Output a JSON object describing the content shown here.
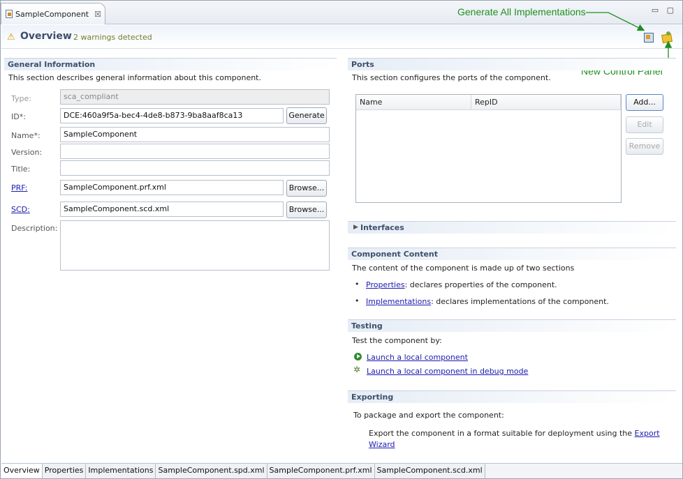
{
  "editor": {
    "tab_label": "SampleComponent",
    "close_glyph": "☒",
    "window_controls": "▭ ▢"
  },
  "header": {
    "title": "Overview",
    "message": "2 warnings detected",
    "generate_icon": "generate-all-implementations-icon",
    "panel_icon": "new-control-panel-icon"
  },
  "annotations": {
    "generate": "Generate All Implementations",
    "panel": "New Control Panel"
  },
  "general": {
    "title": "General Information",
    "description": "This section describes general information about this component.",
    "type_label": "Type:",
    "type_value": "sca_compliant",
    "id_label": "ID*:",
    "id_value": "DCE:460a9f5a-bec4-4de8-b873-9ba8aaf8ca13",
    "generate_button": "Generate",
    "name_label": "Name*:",
    "name_value": "SampleComponent",
    "version_label": "Version:",
    "version_value": "",
    "title_label": "Title:",
    "title_value": "",
    "prf_label": "PRF:",
    "prf_value": "SampleComponent.prf.xml",
    "scd_label": "SCD:",
    "scd_value": "SampleComponent.scd.xml",
    "browse_button": "Browse...",
    "description_label": "Description:",
    "description_value": ""
  },
  "ports": {
    "title": "Ports",
    "description": "This section configures the ports of the component.",
    "columns": [
      "Name",
      "RepID"
    ],
    "add_button": "Add...",
    "edit_button": "Edit",
    "remove_button": "Remove"
  },
  "interfaces": {
    "title": "Interfaces"
  },
  "content": {
    "title": "Component Content",
    "description": "The content of the component is made up of two sections",
    "item1_link": "Properties",
    "item1_text": ": declares properties of the component.",
    "item2_link": "Implementations",
    "item2_text": ": declares implementations of the component."
  },
  "testing": {
    "title": "Testing",
    "description": "Test the component by:",
    "launch_link": "Launch a local component",
    "debug_link": "Launch a local component in debug mode"
  },
  "exporting": {
    "title": "Exporting",
    "description": "To package and export the component:",
    "text": "Export the component in a format suitable for deployment using the",
    "link_part1": "Export",
    "link_part2": "Wizard"
  },
  "pagetabs": [
    "Overview",
    "Properties",
    "Implementations",
    "SampleComponent.spd.xml",
    "SampleComponent.prf.xml",
    "SampleComponent.scd.xml"
  ]
}
